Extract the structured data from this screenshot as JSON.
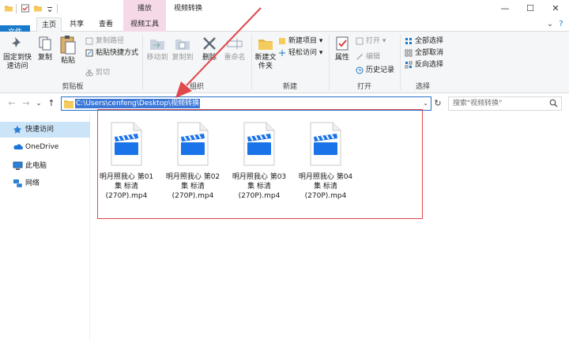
{
  "titlebar": {
    "context_tab": "播放",
    "title": "视频转换",
    "minimize": "—",
    "maximize": "☐",
    "close": "✕"
  },
  "tabs": {
    "file": "文件",
    "home": "主页",
    "share": "共享",
    "view": "查看",
    "video_tools": "视频工具",
    "chevron": "⌄",
    "help": "?"
  },
  "ribbon": {
    "clipboard": {
      "label": "剪贴板",
      "pin": "固定到快速访问",
      "copy": "复制",
      "paste": "粘贴",
      "copy_path": "复制路径",
      "paste_shortcut": "粘贴快捷方式",
      "cut": "剪切"
    },
    "organize": {
      "label": "组织",
      "move_to": "移动到",
      "copy_to": "复制到",
      "delete": "删除",
      "rename": "重命名"
    },
    "new": {
      "label": "新建",
      "new_folder": "新建文件夹",
      "new_item": "新建项目 ▾",
      "easy_access": "轻松访问 ▾"
    },
    "open": {
      "label": "打开",
      "properties": "属性",
      "open": "打开 ▾",
      "edit": "编辑",
      "history": "历史记录"
    },
    "select": {
      "label": "选择",
      "select_all": "全部选择",
      "select_none": "全部取消",
      "invert": "反向选择"
    }
  },
  "address": {
    "back": "←",
    "forward": "→",
    "recent": "⌄",
    "up": "↑",
    "path": "C:\\Users\\cenfeng\\Desktop\\视频转换",
    "dropdown": "⌄",
    "refresh": "↻",
    "search_placeholder": "搜索\"视频转换\""
  },
  "navpane": {
    "items": [
      {
        "label": "快速访问"
      },
      {
        "label": "OneDrive"
      },
      {
        "label": "此电脑"
      },
      {
        "label": "网络"
      }
    ]
  },
  "files": [
    {
      "line1": "明月照我心 第01",
      "line2": "集 标清",
      "line3": "(270P).mp4"
    },
    {
      "line1": "明月照我心 第02",
      "line2": "集 标清",
      "line3": "(270P).mp4"
    },
    {
      "line1": "明月照我心 第03",
      "line2": "集 标清",
      "line3": "(270P).mp4"
    },
    {
      "line1": "明月照我心 第04",
      "line2": "集 标清",
      "line3": "(270P).mp4"
    }
  ],
  "colors": {
    "accent": "#1979ca",
    "context_tab": "#f5d9e8",
    "annotation_red": "#e0484c",
    "video_icon_blue": "#1a73e8"
  }
}
